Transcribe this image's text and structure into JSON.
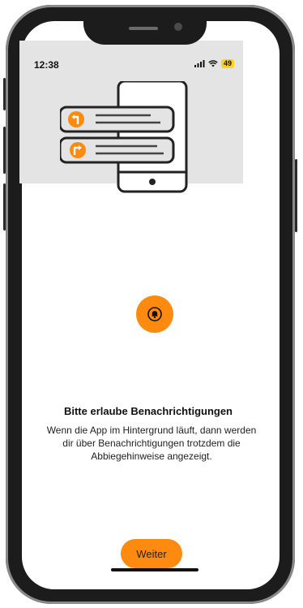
{
  "status_bar": {
    "time": "12:38",
    "battery": "49",
    "signal_icon": "cellular-signal-icon",
    "wifi_icon": "wifi-icon"
  },
  "illustration": {
    "icons": [
      "turn-left-icon",
      "turn-right-icon"
    ]
  },
  "permission": {
    "bell_icon": "bell-icon",
    "title": "Bitte erlaube Benachrichtigungen",
    "description": "Wenn die App im Hintergrund läuft, dann werden dir über Benachrichtigungen trotzdem die Abbiegehinweise angezeigt."
  },
  "actions": {
    "continue_label": "Weiter"
  },
  "colors": {
    "accent": "#ff8a10",
    "hero_bg": "#e4e4e4",
    "battery": "#ffd21f"
  }
}
